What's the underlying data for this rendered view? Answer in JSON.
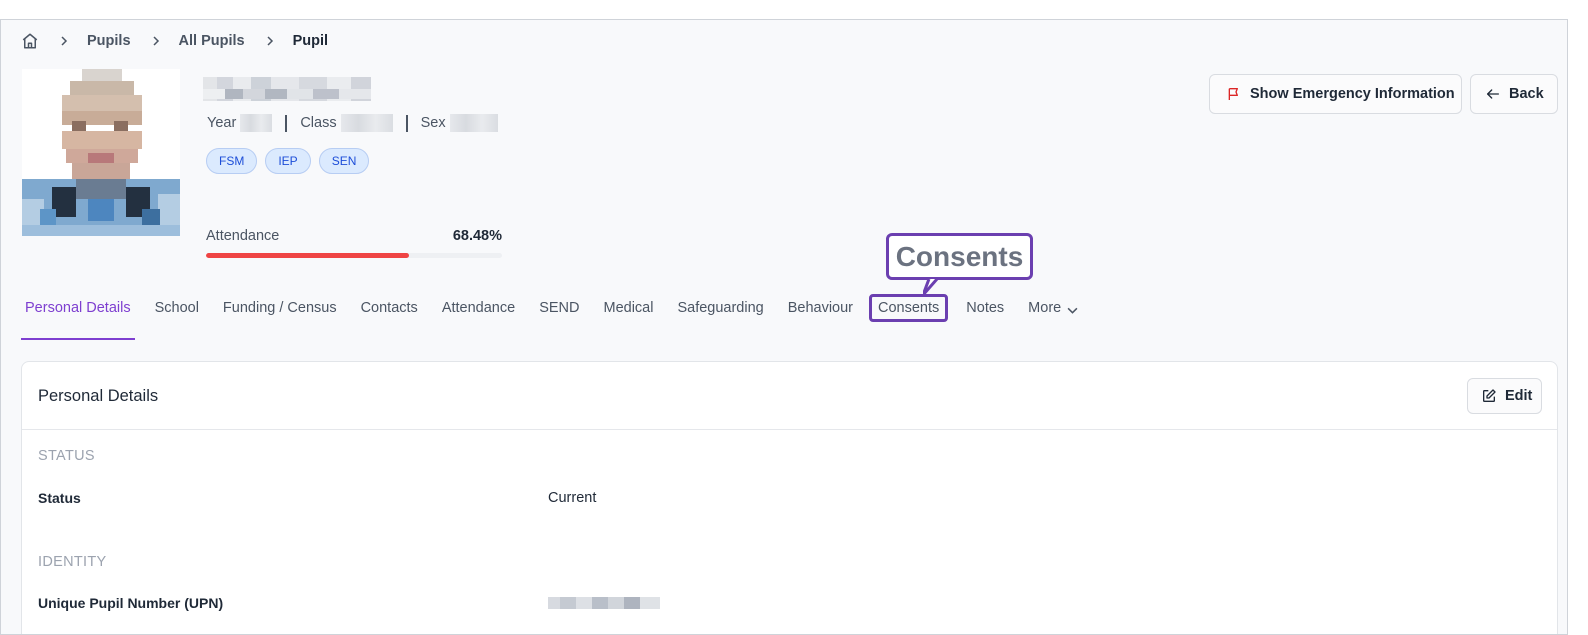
{
  "breadcrumb": {
    "home_icon": "home-icon",
    "items": [
      {
        "label": "Pupils"
      },
      {
        "label": "All Pupils"
      },
      {
        "label": "Pupil"
      }
    ]
  },
  "pupil": {
    "meta": {
      "year_label": "Year",
      "class_label": "Class",
      "sex_label": "Sex"
    },
    "tags": [
      "FSM",
      "IEP",
      "SEN"
    ],
    "attendance": {
      "label": "Attendance",
      "value_text": "68.48%",
      "fraction": 0.6848
    }
  },
  "actions": {
    "emergency_label": "Show Emergency Information",
    "emergency_icon": "flag-icon",
    "back_label": "Back",
    "back_icon": "arrow-left-icon"
  },
  "tabs": [
    {
      "label": "Personal Details"
    },
    {
      "label": "School"
    },
    {
      "label": "Funding / Census"
    },
    {
      "label": "Contacts"
    },
    {
      "label": "Attendance"
    },
    {
      "label": "SEND"
    },
    {
      "label": "Medical"
    },
    {
      "label": "Safeguarding"
    },
    {
      "label": "Behaviour"
    },
    {
      "label": "Consents"
    },
    {
      "label": "Notes"
    },
    {
      "label": "More"
    }
  ],
  "callout": {
    "text": "Consents"
  },
  "card": {
    "title": "Personal Details",
    "edit_label": "Edit",
    "edit_icon": "edit-icon",
    "sections": [
      {
        "label": "STATUS",
        "field_label": "Status",
        "field_value": "Current"
      },
      {
        "label": "IDENTITY",
        "field_label": "Unique Pupil Number (UPN)"
      }
    ]
  },
  "colors": {
    "accent": "#7e3fd0",
    "highlight_border": "#6b3fb0",
    "attendance_bar": "#ef4444",
    "tag_bg": "#dbeafe",
    "tag_text": "#1d4ed8"
  }
}
